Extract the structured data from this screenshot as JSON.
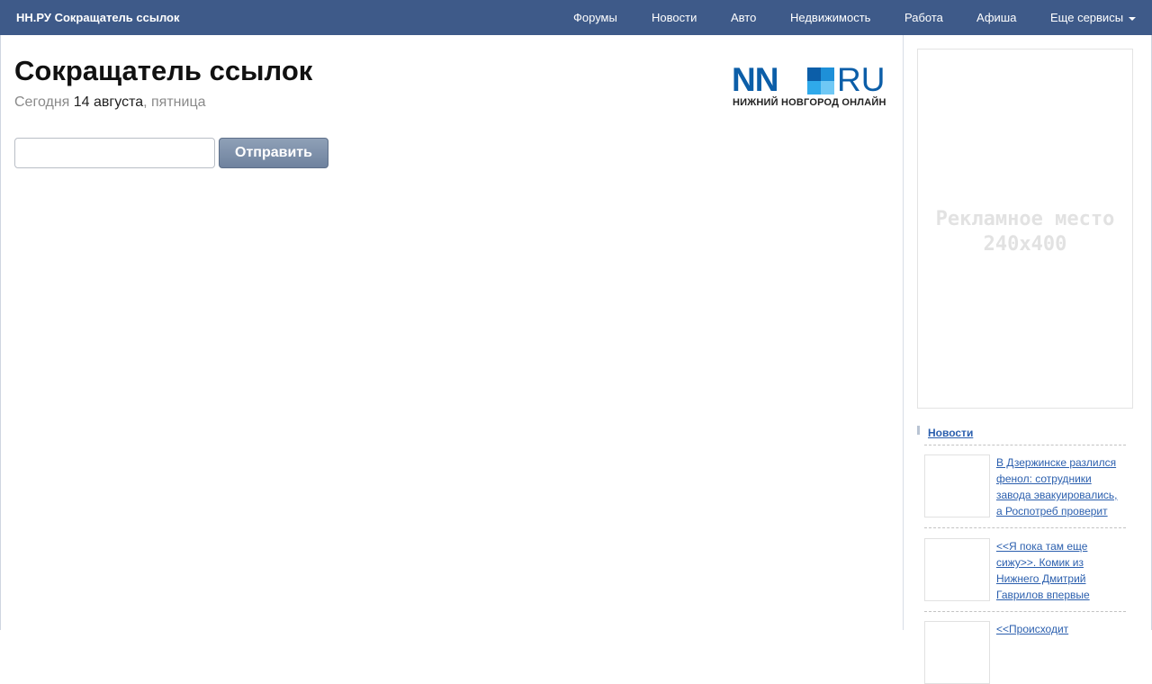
{
  "header": {
    "brand": "НН.РУ Сокращатель ссылок",
    "nav": [
      "Форумы",
      "Новости",
      "Авто",
      "Недвижимость",
      "Работа",
      "Афиша",
      "Еще сервисы"
    ]
  },
  "page": {
    "title": "Сокращатель ссылок",
    "date_prefix": "Сегодня",
    "date_main": "14 августа",
    "date_suffix": ", пятница"
  },
  "logo": {
    "left_text": "NN",
    "right_text": "RU",
    "subtitle": "НИЖНИЙ НОВГОРОД ОНЛАЙН",
    "colors": [
      "#0c5ea8",
      "#1e90d8",
      "#2fa9ea",
      "#6fc8f5"
    ]
  },
  "form": {
    "input_value": "",
    "input_placeholder": "",
    "submit_label": "Отправить"
  },
  "ad": {
    "line1": "Рекламное место",
    "line2": "240x400"
  },
  "news": {
    "heading": "Новости",
    "items": [
      "В Дзержинске разлился фенол: сотрудники завода эвакуировались, а Роспотреб проверит",
      "<<Я пока там еще сижу>>. Комик из Нижнего Дмитрий Гаврилов впервые",
      "<<Происходит"
    ]
  },
  "colors": {
    "topbar": "#3e5a89",
    "link": "#2b5fae",
    "button": "#7587a2"
  }
}
